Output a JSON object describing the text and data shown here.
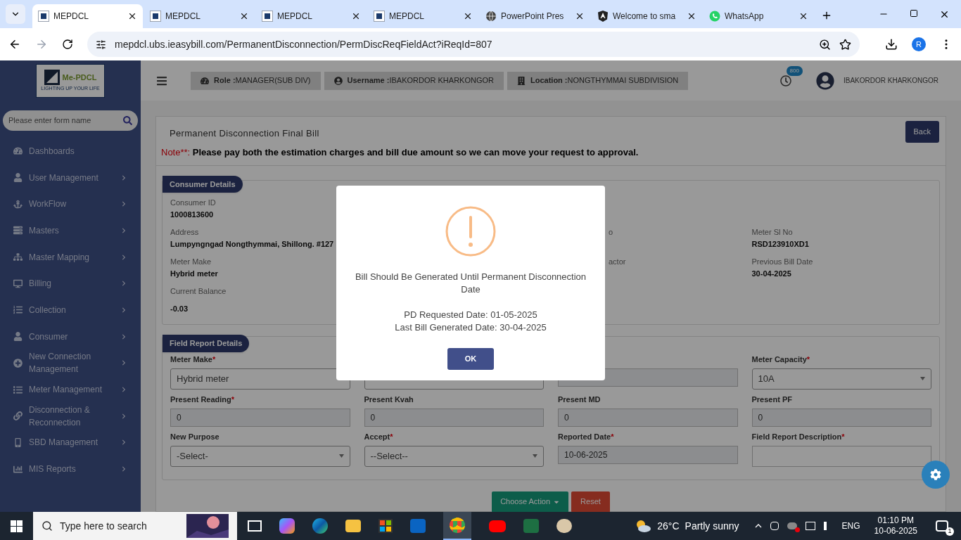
{
  "browser": {
    "tabs": [
      {
        "title": "MEPDCL",
        "selected": true,
        "kind": "logo"
      },
      {
        "title": "MEPDCL",
        "selected": false,
        "kind": "logo"
      },
      {
        "title": "MEPDCL",
        "selected": false,
        "kind": "logo"
      },
      {
        "title": "MEPDCL",
        "selected": false,
        "kind": "logo"
      },
      {
        "title": "PowerPoint Pres",
        "selected": false,
        "kind": "globe"
      },
      {
        "title": "Welcome to sma",
        "selected": false,
        "kind": "angular"
      },
      {
        "title": "WhatsApp",
        "selected": false,
        "kind": "whatsapp"
      }
    ],
    "url": "mepdcl.ubs.ieasybill.com/PermanentDisconnection/PermDiscReqFieldAct?iReqId=807",
    "profile": "R"
  },
  "logo": {
    "name": "Me-PDCL",
    "tagline": "LIGHTING UP YOUR LIFE"
  },
  "sidebar": {
    "search_placeholder": "Please enter form name",
    "items": [
      {
        "label": "Dashboards",
        "has_submenu": false
      },
      {
        "label": "User Management",
        "has_submenu": true
      },
      {
        "label": "WorkFlow",
        "has_submenu": true
      },
      {
        "label": "Masters",
        "has_submenu": true
      },
      {
        "label": "Master Mapping",
        "has_submenu": true
      },
      {
        "label": "Billing",
        "has_submenu": true
      },
      {
        "label": "Collection",
        "has_submenu": true
      },
      {
        "label": "Consumer",
        "has_submenu": true
      },
      {
        "label": "New Connection Management",
        "has_submenu": true
      },
      {
        "label": "Meter Management",
        "has_submenu": true
      },
      {
        "label": "Disconnection & Reconnection",
        "has_submenu": true
      },
      {
        "label": "SBD Management",
        "has_submenu": true
      },
      {
        "label": "MIS Reports",
        "has_submenu": true
      }
    ]
  },
  "header": {
    "chips": [
      {
        "label": "Role :",
        "value": "MANAGER(SUB DIV)",
        "kind": "role"
      },
      {
        "label": "Username :",
        "value": "IBAKORDOR KHARKONGOR",
        "kind": "user"
      },
      {
        "label": "Location :",
        "value": "NONGTHYMMAI SUBDIVISION",
        "kind": "location"
      }
    ],
    "notification_count": "800",
    "user_name": "IBAKORDOR KHARKONGOR"
  },
  "page": {
    "title": "Permanent Disconnection Final Bill",
    "back_button": "Back",
    "note": {
      "prefix": "Note**:",
      "text": "Please pay both the estimation charges and bill due amount so we can move your request to approval."
    },
    "consumer_details": {
      "title": "Consumer Details",
      "rows": [
        [
          {
            "label": "Consumer ID",
            "value": "1000813600"
          },
          null,
          null,
          null
        ],
        [
          {
            "label": "Address",
            "value": "Lumpyngngad Nongthymmai, Shillong. #127"
          },
          null,
          {
            "label": "o"
          },
          {
            "label": "Meter Sl No",
            "value": "RSD123910XD1"
          }
        ],
        [
          {
            "label": "Meter Make",
            "value": "Hybrid meter"
          },
          null,
          {
            "label": "actor"
          },
          {
            "label": "Previous Bill Date",
            "value": "30-04-2025"
          }
        ],
        [
          {
            "label": "Current Balance",
            "value": "-0.03"
          },
          null,
          null,
          null
        ]
      ]
    },
    "field_report": {
      "title": "Field Report Details",
      "required_mark": "*",
      "fields": [
        {
          "label": "Meter Make",
          "required": true,
          "kind": "select",
          "value": "Hybrid meter"
        },
        {
          "kind": "select"
        },
        {
          "kind": "input"
        },
        {
          "label": "Meter Capacity",
          "required": true,
          "kind": "select",
          "value": "10A"
        },
        {
          "label": "Present Reading",
          "required": true,
          "kind": "input",
          "value": "0"
        },
        {
          "label": "Present Kvah",
          "required": false,
          "kind": "input",
          "value": "0"
        },
        {
          "label": "Present MD",
          "required": false,
          "kind": "input",
          "value": "0"
        },
        {
          "label": "Present PF",
          "required": false,
          "kind": "input",
          "value": "0"
        },
        {
          "label": "New Purpose",
          "required": false,
          "kind": "select",
          "value": "-Select-"
        },
        {
          "label": "Accept",
          "required": true,
          "kind": "select",
          "value": "--Select--"
        },
        {
          "label": "Reported Date",
          "required": true,
          "kind": "input",
          "value": "10-06-2025"
        },
        {
          "label": "Field Report Description",
          "required": true,
          "kind": "textarea"
        }
      ]
    },
    "actions": [
      {
        "label": "Choose Action",
        "kind": "dropdown"
      },
      {
        "label": "Reset",
        "kind": "reset"
      }
    ]
  },
  "dialog": {
    "message": "Bill Should Be Generated Until Permanent Disconnection Date",
    "lines": [
      "PD Requested Date: 01-05-2025",
      "Last Bill Generated Date: 30-04-2025"
    ],
    "ok_button": "OK"
  },
  "taskbar": {
    "search_placeholder": "Type here to search",
    "temperature": "26°C",
    "weather": "Partly sunny",
    "language": "ENG",
    "time": "01:10 PM",
    "date": "10-06-2025",
    "notifications": "1"
  }
}
